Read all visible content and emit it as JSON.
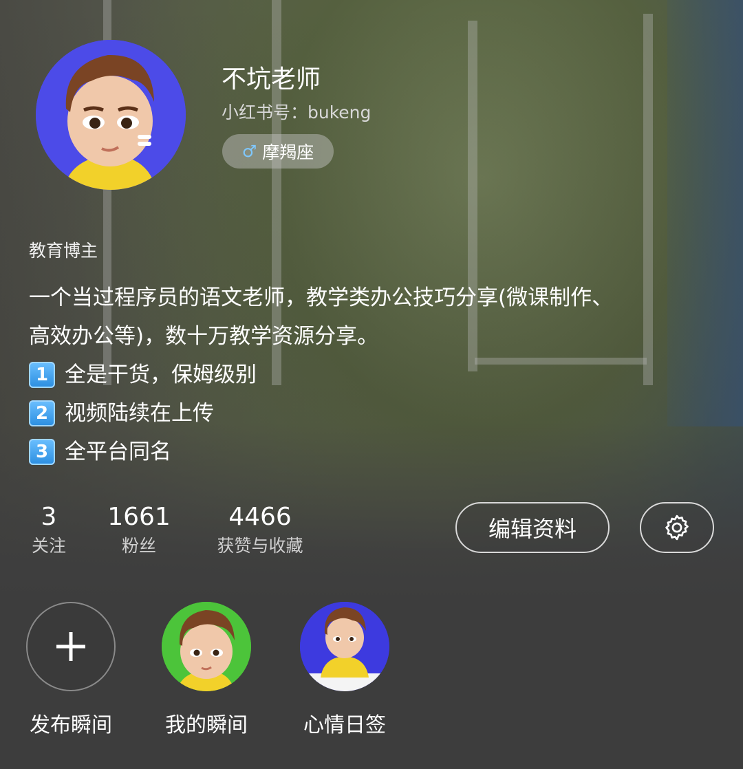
{
  "profile": {
    "nickname": "不坑老师",
    "account_id": "小红书号：bukeng",
    "zodiac": {
      "icon": "male-symbol-icon",
      "label": "摩羯座"
    },
    "category": "教育博主",
    "bio_lines": [
      "一个当过程序员的语文老师，教学类办公技巧分享(微课制作、",
      "高效办公等)，数十万教学资源分享。"
    ],
    "bio_items": [
      {
        "badge": "1",
        "text": "全是干货，保姆级别"
      },
      {
        "badge": "2",
        "text": "视频陆续在上传"
      },
      {
        "badge": "3",
        "text": "全平台同名"
      }
    ]
  },
  "stats": {
    "following": {
      "value": "3",
      "label": "关注"
    },
    "followers": {
      "value": "1661",
      "label": "粉丝"
    },
    "likes": {
      "value": "4466",
      "label": "获赞与收藏"
    }
  },
  "actions": {
    "edit_label": "编辑资料",
    "settings_icon": "gear-icon"
  },
  "moments": [
    {
      "label": "发布瞬间",
      "icon": "plus-icon"
    },
    {
      "label": "我的瞬间",
      "color": "#4cc43a"
    },
    {
      "label": "心情日签",
      "color": "#3d3adf"
    }
  ],
  "colors": {
    "avatar_bg": "#4c4be8",
    "accent_blue": "#7fc8ff"
  }
}
